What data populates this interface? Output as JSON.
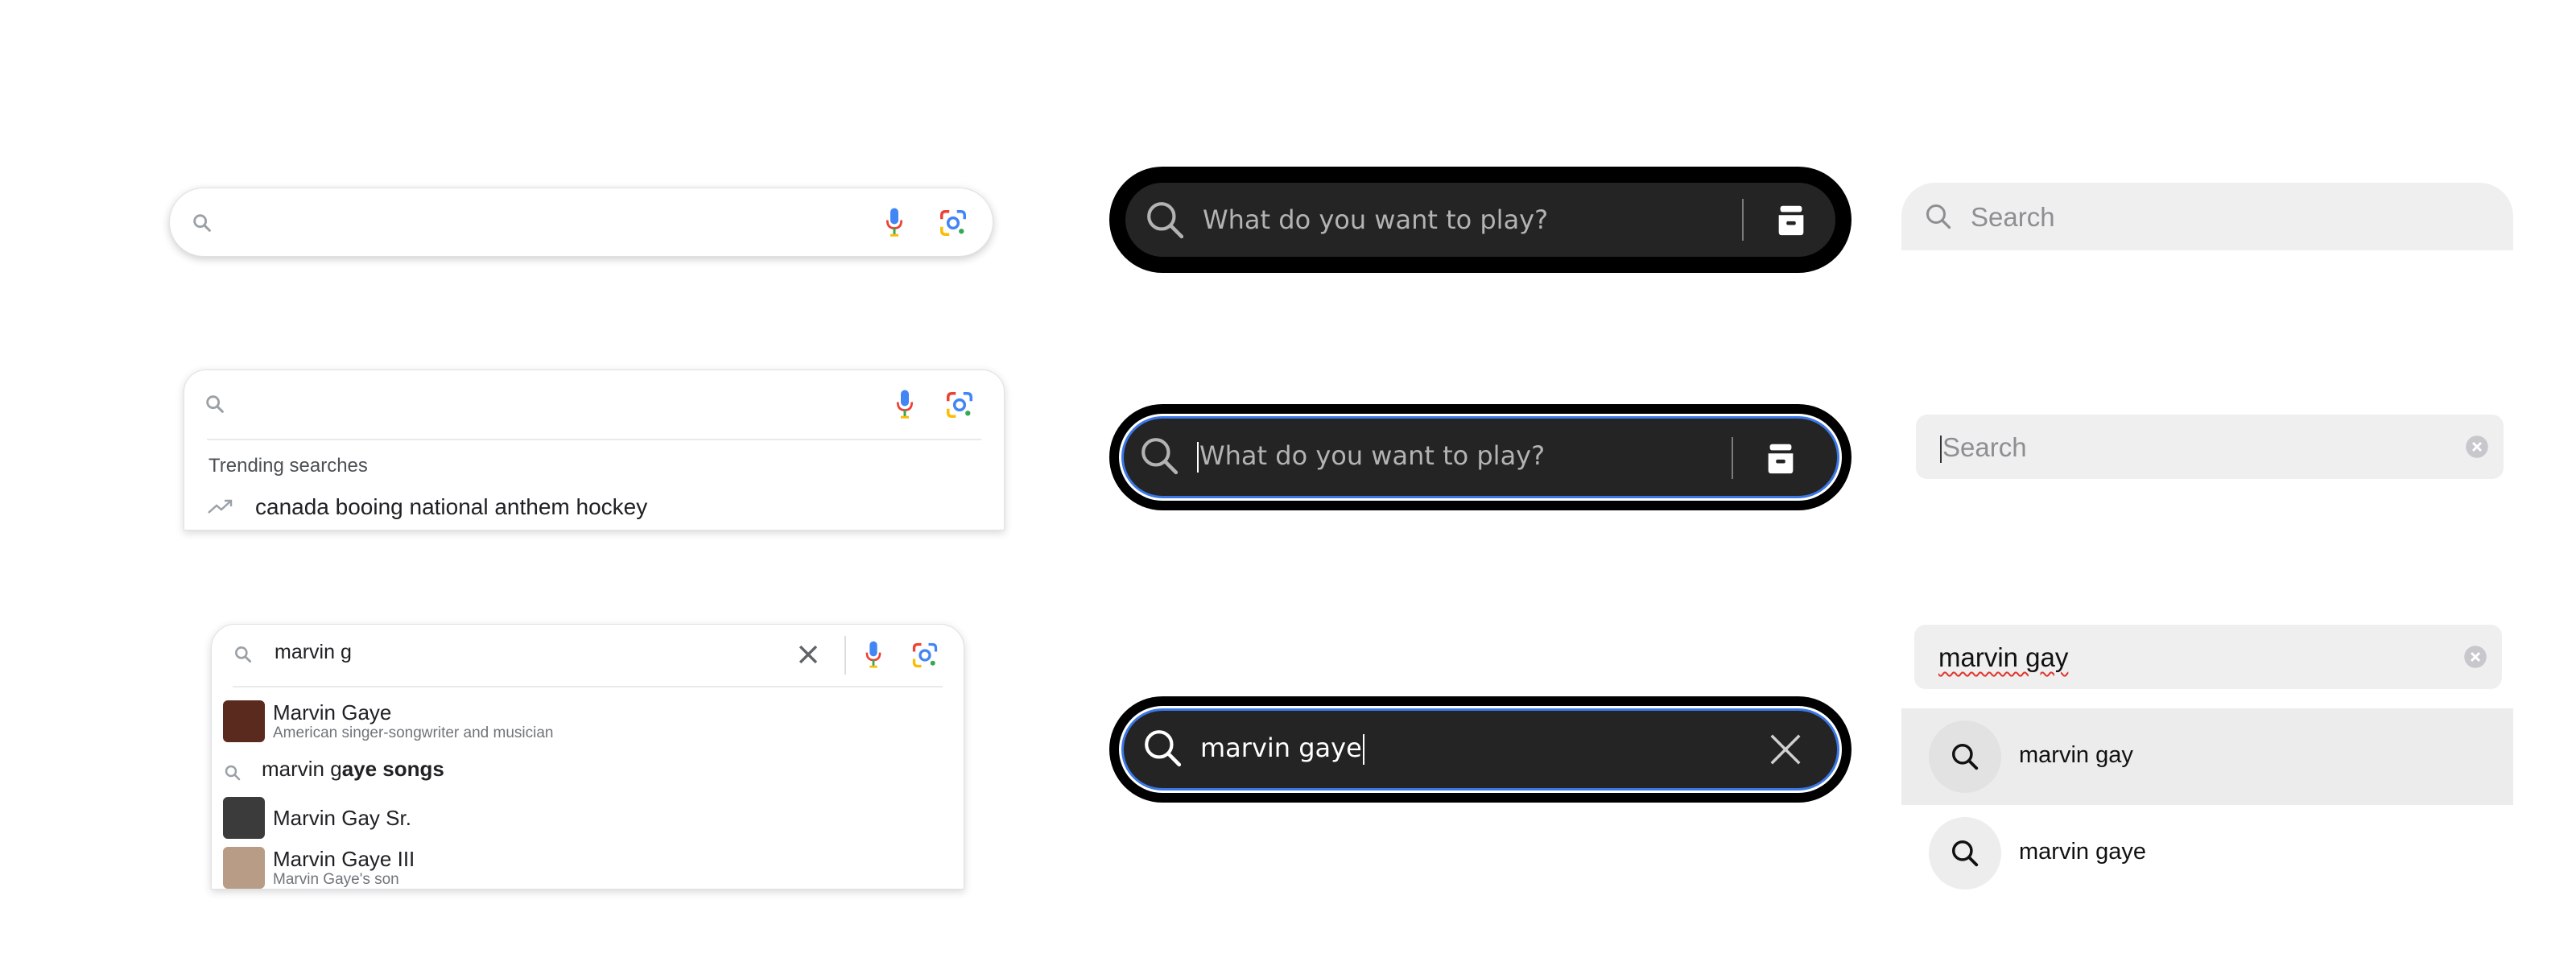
{
  "google": {
    "empty": {
      "query": ""
    },
    "focused": {
      "query": "",
      "trending_header": "Trending searches",
      "trending_items": [
        "canada booing national anthem hockey"
      ]
    },
    "typing": {
      "query": "marvin g",
      "suggestions": [
        {
          "type": "entity",
          "title": "Marvin Gaye",
          "subtitle": "American singer-songwriter and musician",
          "thumb_color": "#5b2a1f"
        },
        {
          "type": "query",
          "prefix": "marvin g",
          "completion": "aye songs"
        },
        {
          "type": "entity",
          "title": "Marvin Gay Sr.",
          "subtitle": "",
          "thumb_color": "#3b3b3b"
        },
        {
          "type": "entity",
          "title": "Marvin Gaye III",
          "subtitle": "Marvin Gaye's son",
          "thumb_color": "#b89c86"
        }
      ]
    }
  },
  "spotify": {
    "placeholder": "What do you want to play?",
    "empty": {
      "placeholder": "What do you want to play?"
    },
    "focused": {
      "placeholder": "What do you want to play?"
    },
    "typing": {
      "query": "marvin gaye"
    }
  },
  "apple": {
    "empty": {
      "placeholder": "Search"
    },
    "focused": {
      "placeholder": "Search"
    },
    "typing": {
      "query": "marvin gay",
      "suggestions": [
        "marvin gay",
        "marvin gaye"
      ]
    }
  },
  "colors": {
    "spotify_bg": "#000000",
    "spotify_field": "#242424",
    "focus_ring": "#3b78e7",
    "apple_field": "#efefef",
    "google_border": "#dfe1e5"
  }
}
